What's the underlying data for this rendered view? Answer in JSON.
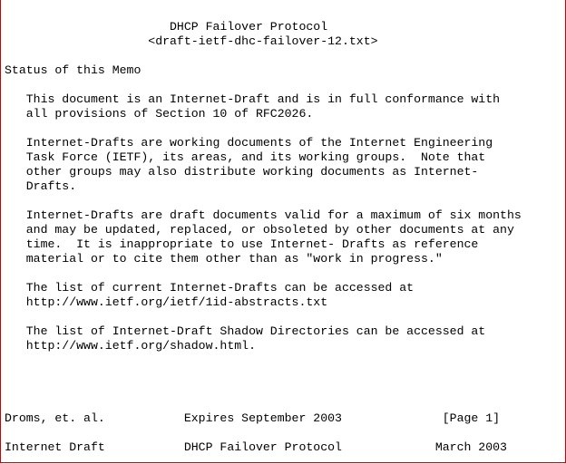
{
  "document": {
    "header_title": "                       DHCP Failover Protocol",
    "header_filename": "                    <draft-ietf-dhc-failover-12.txt>",
    "status_heading": "Status of this Memo",
    "paragraphs": [
      [
        "   This document is an Internet-Draft and is in full conformance with",
        "   all provisions of Section 10 of RFC2026."
      ],
      [
        "   Internet-Drafts are working documents of the Internet Engineering",
        "   Task Force (IETF), its areas, and its working groups.  Note that",
        "   other groups may also distribute working documents as Internet-",
        "   Drafts."
      ],
      [
        "   Internet-Drafts are draft documents valid for a maximum of six months",
        "   and may be updated, replaced, or obsoleted by other documents at any",
        "   time.  It is inappropriate to use Internet- Drafts as reference",
        "   material or to cite them other than as \"work in progress.\""
      ],
      [
        "   The list of current Internet-Drafts can be accessed at",
        "   http://www.ietf.org/ietf/1id-abstracts.txt"
      ],
      [
        "   The list of Internet-Draft Shadow Directories can be accessed at",
        "   http://www.ietf.org/shadow.html."
      ]
    ],
    "footer": "Droms, et. al.           Expires September 2003              [Page 1]",
    "next_header": "Internet Draft           DHCP Failover Protocol             March 2003"
  }
}
